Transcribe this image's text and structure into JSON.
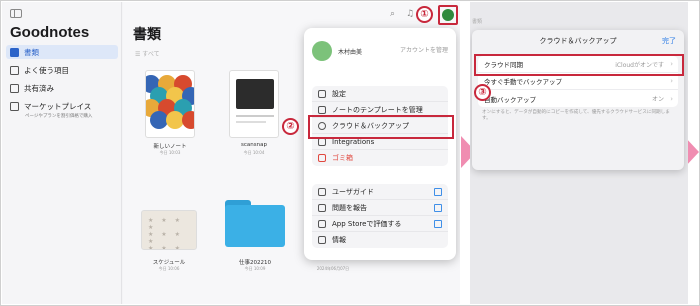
{
  "left_app": {
    "app_title": "Goodnotes",
    "sidebar": {
      "items": [
        {
          "label": "書類",
          "active": true
        },
        {
          "label": "よく使う項目"
        },
        {
          "label": "共有済み"
        },
        {
          "label": "マーケットプレイス"
        }
      ],
      "marketplace_sub": "ページやプランを割引価格で購入"
    },
    "main": {
      "title": "書類",
      "filter": "すべて",
      "items": [
        {
          "label": "新しいノート",
          "date": "今日 10:03"
        },
        {
          "label": "scansnap",
          "date": "今日 10:04"
        },
        {
          "label": "スケジュール",
          "date": "今日 10:06"
        },
        {
          "label": "仕事202210",
          "date": "今日 10:09"
        }
      ],
      "bottom_date": "2024年06月07日"
    },
    "popover": {
      "account_name": "木村由美",
      "account_link": "アカウントを管理",
      "group1": [
        "設定",
        "ノートのテンプレートを管理",
        "クラウド＆バックアップ",
        "Integrations",
        "ゴミ箱"
      ],
      "group2": [
        "ユーザガイド",
        "問題を報告",
        "App Storeで評価する",
        "情報"
      ]
    }
  },
  "right_app": {
    "bg_text": "書類",
    "panel_title": "クラウド＆バックアップ",
    "done_label": "完了",
    "rows": [
      {
        "label": "クラウド同期",
        "value": "iCloudがオンです"
      },
      {
        "label": "今すぐ手動でバックアップ",
        "value": ""
      },
      {
        "label": "自動バックアップ",
        "value": "オン"
      }
    ],
    "note": "オンにすると、データが自動的にコピーを作成して、優先するクラウドサービスに同期します。"
  },
  "annotations": {
    "step1": "①",
    "step2": "②",
    "step3": "③"
  },
  "colors": {
    "accent_red": "#c8283c",
    "arrow_pink": "#f08db1",
    "link_blue": "#2f7ee6"
  }
}
